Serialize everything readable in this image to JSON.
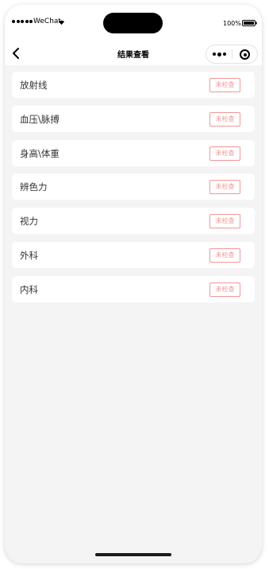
{
  "status_bar": {
    "carrier": "WeChat",
    "battery_percent": "100%",
    "signal_icon": "signal-dots-icon",
    "wifi_icon": "wifi-icon",
    "battery_icon": "battery-icon"
  },
  "nav": {
    "title": "结果查看",
    "back_icon": "chevron-left-icon",
    "more_icon": "more-dots-icon",
    "close_icon": "target-circle-icon"
  },
  "items": [
    {
      "label": "放射线",
      "status": "未检查"
    },
    {
      "label": "血压\\脉搏",
      "status": "未检查"
    },
    {
      "label": "身高\\体重",
      "status": "未检查"
    },
    {
      "label": "辨色力",
      "status": "未检查"
    },
    {
      "label": "视力",
      "status": "未检查"
    },
    {
      "label": "外科",
      "status": "未检查"
    },
    {
      "label": "内科",
      "status": "未检查"
    }
  ],
  "colors": {
    "badge": "#f19797",
    "background": "#f4f4f4",
    "card": "#ffffff"
  }
}
